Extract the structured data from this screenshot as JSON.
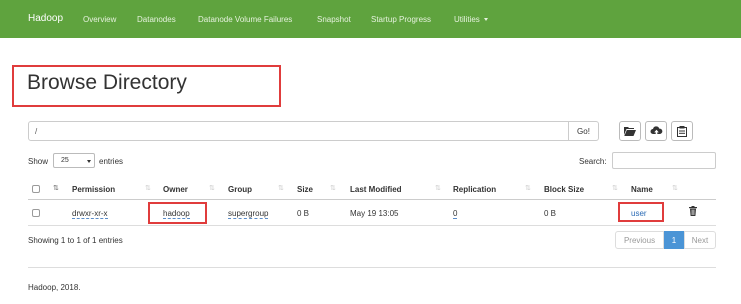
{
  "navbar": {
    "brand": "Hadoop",
    "links": [
      "Overview",
      "Datanodes",
      "Datanode Volume Failures",
      "Snapshot",
      "Startup Progress",
      "Utilities"
    ]
  },
  "page": {
    "title": "Browse Directory"
  },
  "path": {
    "value": "/",
    "go_label": "Go!"
  },
  "toolbar": {
    "icons": [
      "folder-open-icon",
      "cloud-upload-icon",
      "clipboard-icon"
    ]
  },
  "table_controls": {
    "show_label": "Show",
    "page_size": "25",
    "entries_label": "entries",
    "search_label": "Search:"
  },
  "table": {
    "headers": [
      "Permission",
      "Owner",
      "Group",
      "Size",
      "Last Modified",
      "Replication",
      "Block Size",
      "Name"
    ],
    "rows": [
      {
        "permission": "drwxr-xr-x",
        "owner": "hadoop",
        "group": "supergroup",
        "size": "0 B",
        "last_modified": "May 19 13:05",
        "replication": "0",
        "block_size": "0 B",
        "name": "user"
      }
    ]
  },
  "pagination": {
    "info": "Showing 1 to 1 of 1 entries",
    "previous": "Previous",
    "current": "1",
    "next": "Next"
  },
  "footer": {
    "text": "Hadoop, 2018."
  },
  "colors": {
    "navbar": "#5fa33e",
    "highlight_box": "#e03c3c",
    "active_page": "#4a94d6",
    "link": "#2a6ab5"
  }
}
